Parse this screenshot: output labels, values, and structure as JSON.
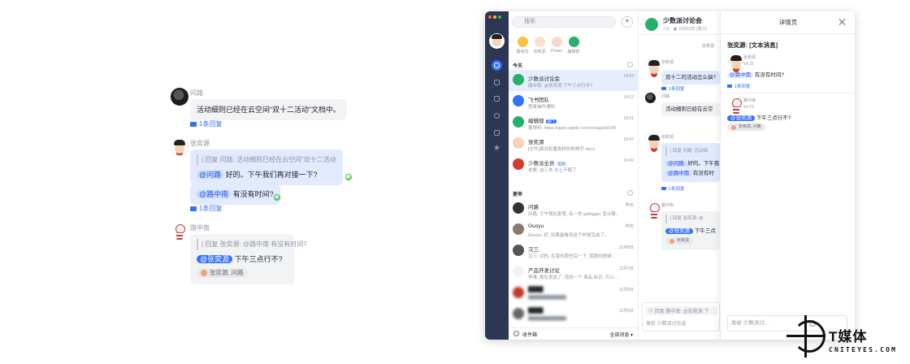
{
  "left_thread": {
    "msg1": {
      "sender": "问路",
      "text": "活动细则已经在云空间“双十二活动”文档中。",
      "reply_count": "1条回复"
    },
    "msg2": {
      "sender": "张奕源",
      "quote": "| 回复 问路: 活动细则已经在云空间“双十二活动”文档中。",
      "mention1": "@问路",
      "text1": " 好的。下午我们再对接一下?",
      "mention2": "@路中南",
      "text2": " 有没有时间?",
      "reply_count": "1条回复"
    },
    "msg3": {
      "sender": "路中南",
      "quote": "| 回复 张奕源: @路中南 有没有时间?",
      "mention": "@张奕源",
      "text": " 下午三点行不?",
      "reaction_users": "张奕源, 问路"
    }
  },
  "app": {
    "search_placeholder": "搜索",
    "plus": "+",
    "pinned": [
      {
        "label": "薯考拉",
        "color": "#f5c342"
      },
      {
        "label": "张奕源",
        "color": "#fbe0d0"
      },
      {
        "label": "Power",
        "color": "#f9d5cf"
      },
      {
        "label": "编辑部",
        "color": "#27b06a"
      }
    ],
    "section_today": "今天",
    "section_earlier": "更早",
    "today_rows": [
      {
        "name": "少数派讨论会",
        "preview": "路中南: @张奕源 下午三点行不?",
        "time": "14:23",
        "color": "#27b06a",
        "selected": true
      },
      {
        "name": "飞书团队",
        "preview": "登录操作通知",
        "time": "14:12",
        "color": "#3370ff"
      },
      {
        "name": "编辑部",
        "tag": "部门",
        "preview": "董博科: https://apps.apple.com/cn/app/id148...",
        "time": "10:51",
        "color": "#27b06a"
      },
      {
        "name": "张奕源",
        "preview": "[文件]面对轮番各样的购物节.docx",
        "time": "10:47",
        "color": "#f6d3b5"
      },
      {
        "name": "少数派全员",
        "tag": "全员",
        "preview": "老紫: @三本 水土不服了",
        "time": "10:42",
        "color": "#d33b2f"
      }
    ],
    "earlier_rows": [
      {
        "name": "问路",
        "preview": "问路: 下午我在家里, 有一些 gobigger 显示器...",
        "time": "昨天",
        "color": "#333"
      },
      {
        "name": "Guoyu",
        "preview": "Guoyu: 好, 如果能看到这个时候完成了。",
        "time": "昨天",
        "color": "#8a7a6a"
      },
      {
        "name": "汉三",
        "preview": "汉三: 对的, 在我的那些后一下, 我那的稍候...",
        "time": "12月8日",
        "color": "#555"
      },
      {
        "name": "产品开发讨论",
        "preview": "李唯: 那在发送了, 增加一个 商品 标识, 可以...",
        "time": "12月7日",
        "color": "#f2f3f5"
      },
      {
        "name": "████",
        "preview": "████████████",
        "time": "12月5日",
        "color": "#c0392b",
        "blur": true
      },
      {
        "name": "████",
        "preview": "████████████",
        "time": "12月5日",
        "color": "#666",
        "blur": true
      }
    ],
    "footer_left": "收件箱",
    "footer_right": "全部消息 ▾",
    "chat": {
      "title": "少数派讨论会",
      "meta_members": "3",
      "meta_date": "12月11日 (周六)",
      "top_sender": "张奕源",
      "m1_sender": "张奕源",
      "m1_text": "双十二的活动怎么搞?",
      "m1_reply": "1条回复",
      "m2_sender": "问路",
      "m2_text": "活动细则已经在云空",
      "m3_sender": "张奕源",
      "m3_quote": "| 回复 问路: 活动细",
      "m3_mention1": "@问路",
      "m3_text1": " 好的。下午我",
      "m3_mention2": "@路中南",
      "m3_text2": " 有没有时",
      "m3_reply": "1条回复",
      "m4_sender": "路中南",
      "m4_quote": "| 回复 张奕源: @",
      "m4_mention": "@张奕源",
      "m4_text": " 下午三点",
      "m4_reaction": "张奕源",
      "composer_quote": "回复 路中南: @张奕源 下",
      "composer_placeholder": "发给 少数派讨论会"
    },
    "detail": {
      "title": "详情页",
      "heading": "张奕源: [文本消息]",
      "a_sender": "张奕源",
      "a_time": "14:23",
      "a_mention": "@路中南",
      "a_text": " 有没有时间?",
      "a_reply": "1条回复",
      "b_sender": "路中南",
      "b_time": "14:23",
      "b_mention": "@张奕源",
      "b_text": " 下午三点行不?",
      "b_reaction": "张奕源, 问路",
      "input_placeholder": "发给 少数派讨..."
    }
  },
  "watermark": {
    "text": "T媒体",
    "url": "CNITEYES.COM"
  }
}
